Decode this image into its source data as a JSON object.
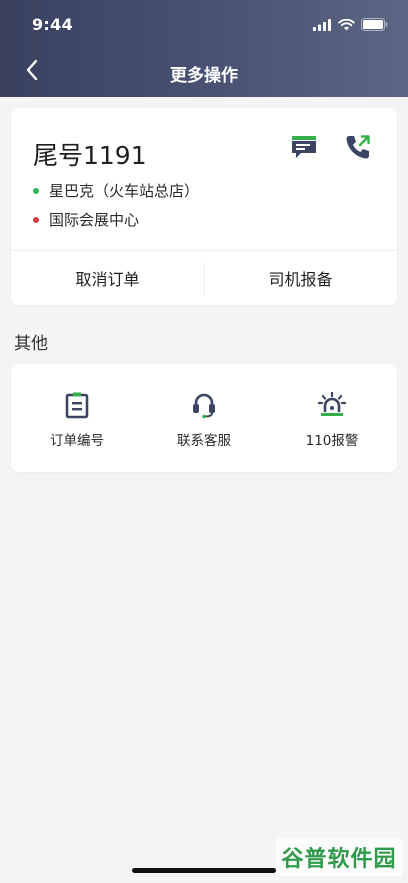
{
  "status_bar": {
    "time": "9:44",
    "icons": [
      "cellular-signal-icon",
      "wifi-icon",
      "battery-icon"
    ]
  },
  "nav": {
    "back_icon": "chevron-left-icon",
    "title": "更多操作"
  },
  "order": {
    "tail_number": "尾号1191",
    "message_icon": "message-icon",
    "call_icon": "phone-call-icon",
    "from": "星巴克（火车站总店）",
    "to": "国际会展中心",
    "cancel_label": "取消订单",
    "report_label": "司机报备"
  },
  "others": {
    "section_title": "其他",
    "items": [
      {
        "label": "订单编号",
        "icon": "clipboard-icon"
      },
      {
        "label": "联系客服",
        "icon": "headset-icon"
      },
      {
        "label": "110报警",
        "icon": "alarm-light-icon"
      }
    ]
  },
  "watermark": "谷普软件园",
  "colors": {
    "header_start": "#39415f",
    "header_end": "#5d6584",
    "accent_green": "#33b04a",
    "origin_dot": "#2fb44f",
    "destination_dot": "#d43a3a",
    "icon_navy": "#3b4563"
  }
}
